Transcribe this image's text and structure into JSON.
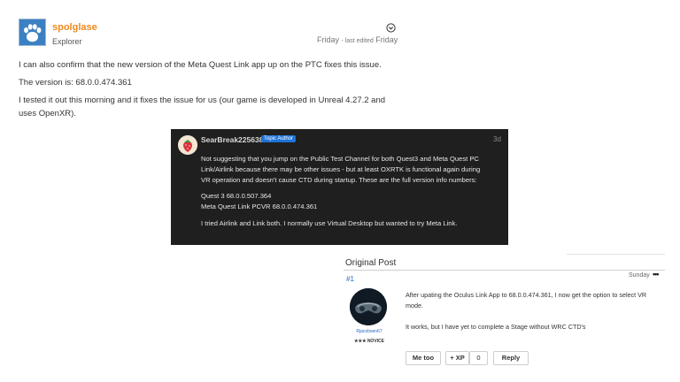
{
  "post": {
    "username": "spolglase",
    "role": "Explorer",
    "date_prefix": "Friday",
    "edited_label": "- last edited",
    "edited_date": "Friday",
    "paragraphs": [
      "I can also confirm that the new version of the Meta Quest Link app up on the PTC fixes this issue.",
      "The version is: 68.0.0.474.361",
      "I tested it out this morning and it fixes the issue for us (our game is developed in Unreal 4.27.2 and uses OpenXR)."
    ]
  },
  "quoted": {
    "username": "SearBreak225638",
    "badge": "Topic Author",
    "time": "3d",
    "body": [
      "Not suggesting that you jump on the Public Test Channel for both Quest3 and Meta Quest PC",
      "Link/Airlink because there may be other issues - but at least OXRTK is functional again during",
      "VR operation and doesn't cause CTD during startup. These are the full version info numbers:"
    ],
    "versions": [
      "Quest 3 68.0.0.507.364",
      "Meta Quest Link PCVR 68.0.0.474.361"
    ],
    "footer": "I tried Airlink and Link both. I normally use Virtual Desktop but wanted to try Meta Link."
  },
  "original_post": {
    "title": "Original Post",
    "number": "#1",
    "day": "Sunday",
    "more": "•••",
    "username": "Rjacobsen67",
    "rank": "★★★ NOVICE",
    "text": [
      "After upating the Oculus Link App to 68.0.0.474.361, I now get the option to select VR",
      "mode.",
      "It works, but I have yet to complete a Stage without WRC CTD's"
    ],
    "buttons": {
      "me_too": "Me too",
      "xp": "+ XP",
      "xp_count": "0",
      "reply": "Reply"
    }
  },
  "colors": {
    "username": "#f08a1c",
    "link": "#2266cc",
    "badge": "#1e73d8",
    "dark_bg": "#1f1f1f"
  },
  "icons": [
    "avatar-paw-icon",
    "options-chevron-icon",
    "more-dots-icon"
  ]
}
